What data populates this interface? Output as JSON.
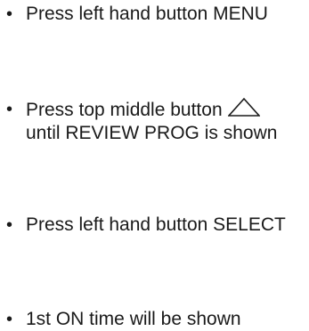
{
  "steps": [
    {
      "bullet": "•",
      "lines": [
        "Press left hand button MENU"
      ]
    },
    {
      "bullet": "•",
      "lines": [
        "Press top middle button",
        "until REVIEW PROG is shown"
      ],
      "icon": "up-triangle-icon"
    },
    {
      "bullet": "•",
      "lines": [
        "Press left hand button SELECT"
      ]
    },
    {
      "bullet": "•",
      "lines": [
        "1st ON time will be shown"
      ]
    }
  ]
}
